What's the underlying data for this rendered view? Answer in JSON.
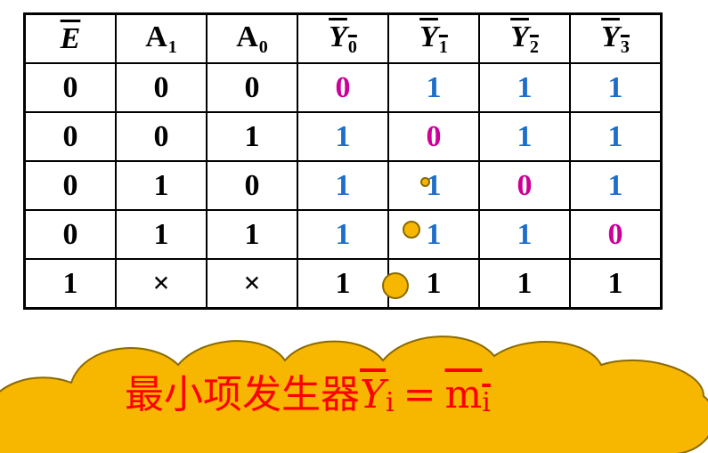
{
  "colors": {
    "one": "#1e6fc9",
    "zero_highlight": "#cc0099",
    "plain": "#000000",
    "cloud_fill": "#f7b700",
    "caption": "#ff0000"
  },
  "headers": [
    {
      "main": "E",
      "sub": "",
      "overline": true
    },
    {
      "main": "A",
      "sub": "1",
      "overline": false
    },
    {
      "main": "A",
      "sub": "0",
      "overline": false
    },
    {
      "main": "Y",
      "sub": "0",
      "overline": true
    },
    {
      "main": "Y",
      "sub": "1",
      "overline": true
    },
    {
      "main": "Y",
      "sub": "2",
      "overline": true
    },
    {
      "main": "Y",
      "sub": "3",
      "overline": true
    }
  ],
  "rows": [
    [
      {
        "v": "0",
        "c": "plain"
      },
      {
        "v": "0",
        "c": "plain"
      },
      {
        "v": "0",
        "c": "plain"
      },
      {
        "v": "0",
        "c": "zero_highlight"
      },
      {
        "v": "1",
        "c": "one"
      },
      {
        "v": "1",
        "c": "one"
      },
      {
        "v": "1",
        "c": "one"
      }
    ],
    [
      {
        "v": "0",
        "c": "plain"
      },
      {
        "v": "0",
        "c": "plain"
      },
      {
        "v": "1",
        "c": "plain"
      },
      {
        "v": "1",
        "c": "one"
      },
      {
        "v": "0",
        "c": "zero_highlight"
      },
      {
        "v": "1",
        "c": "one"
      },
      {
        "v": "1",
        "c": "one"
      }
    ],
    [
      {
        "v": "0",
        "c": "plain"
      },
      {
        "v": "1",
        "c": "plain"
      },
      {
        "v": "0",
        "c": "plain"
      },
      {
        "v": "1",
        "c": "one"
      },
      {
        "v": "1",
        "c": "one"
      },
      {
        "v": "0",
        "c": "zero_highlight"
      },
      {
        "v": "1",
        "c": "one"
      }
    ],
    [
      {
        "v": "0",
        "c": "plain"
      },
      {
        "v": "1",
        "c": "plain"
      },
      {
        "v": "1",
        "c": "plain"
      },
      {
        "v": "1",
        "c": "one"
      },
      {
        "v": "1",
        "c": "one"
      },
      {
        "v": "1",
        "c": "one"
      },
      {
        "v": "0",
        "c": "zero_highlight"
      }
    ],
    [
      {
        "v": "1",
        "c": "plain"
      },
      {
        "v": "×",
        "c": "plain",
        "cross": true
      },
      {
        "v": "×",
        "c": "plain",
        "cross": true
      },
      {
        "v": "1",
        "c": "plain"
      },
      {
        "v": "1",
        "c": "plain"
      },
      {
        "v": "1",
        "c": "plain"
      },
      {
        "v": "1",
        "c": "plain"
      }
    ]
  ],
  "caption": {
    "text": "最小项发生器",
    "y_symbol": "Y",
    "y_sub": "i",
    "equals": "=",
    "m_symbol": "m",
    "m_sub": "i"
  }
}
